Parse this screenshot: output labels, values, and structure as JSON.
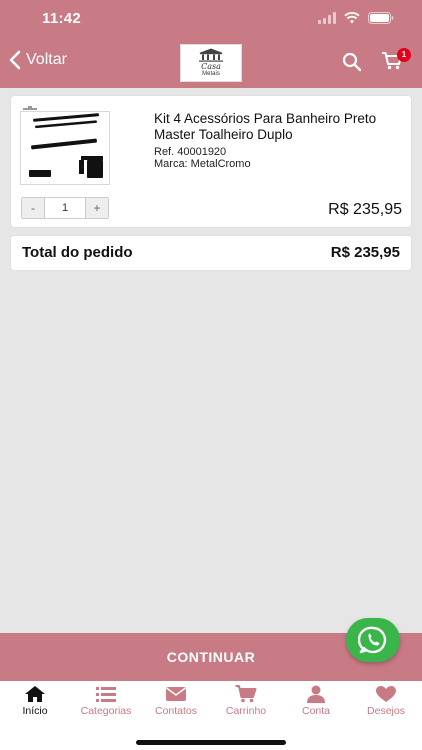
{
  "status": {
    "time": "11:42"
  },
  "nav": {
    "back_label": "Voltar",
    "logo_text": "Casa",
    "logo_sub": "Metais",
    "cart_count": "1"
  },
  "product": {
    "title": "Kit 4 Acessórios Para Banheiro Preto Master Toalheiro Duplo",
    "ref": "Ref. 40001920",
    "brand": "Marca: MetalCromo",
    "qty_minus": "-",
    "quantity": "1",
    "qty_plus": "+",
    "price": "R$ 235,95"
  },
  "total": {
    "label": "Total do pedido",
    "value": "R$ 235,95"
  },
  "continue_label": "CONTINUAR",
  "tabs": [
    {
      "label": "Início",
      "icon": "home-icon"
    },
    {
      "label": "Categorias",
      "icon": "list-icon"
    },
    {
      "label": "Contatos",
      "icon": "mail-icon"
    },
    {
      "label": "Carrinho",
      "icon": "cart-icon"
    },
    {
      "label": "Conta",
      "icon": "user-icon"
    },
    {
      "label": "Desejos",
      "icon": "heart-icon"
    }
  ],
  "colors": {
    "brand": "#c87a85",
    "whatsapp": "#3ab54a",
    "badge": "#e2001a",
    "background": "#e6e6e6"
  }
}
